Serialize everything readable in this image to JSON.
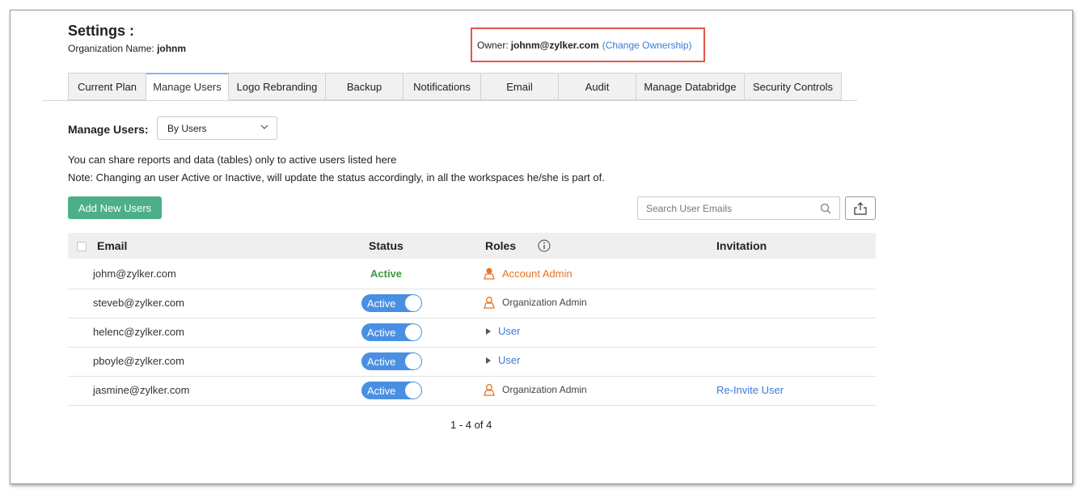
{
  "header": {
    "title": "Settings :",
    "org_label": "Organization Name:",
    "org_name": "johnm",
    "owner_label": "Owner:",
    "owner_email": "johnm@zylker.com",
    "change_ownership": "(Change Ownership)"
  },
  "tabs": [
    {
      "label": "Current Plan",
      "active": false
    },
    {
      "label": "Manage Users",
      "active": true
    },
    {
      "label": "Logo Rebranding",
      "active": false
    },
    {
      "label": "Backup",
      "active": false
    },
    {
      "label": "Notifications",
      "active": false
    },
    {
      "label": "Email",
      "active": false
    },
    {
      "label": "Audit",
      "active": false
    },
    {
      "label": "Manage Databridge",
      "active": false
    },
    {
      "label": "Security Controls",
      "active": false
    }
  ],
  "manage_users": {
    "label": "Manage Users:",
    "select_value": "By Users",
    "info_line1": "You can share reports and data (tables) only to active users listed here",
    "info_line2": "Note: Changing an user Active or Inactive, will update the status accordingly, in all the workspaces he/she is part of.",
    "add_button": "Add New Users",
    "search_placeholder": "Search User Emails"
  },
  "table": {
    "columns": {
      "email": "Email",
      "status": "Status",
      "roles": "Roles",
      "invitation": "Invitation"
    },
    "rows": [
      {
        "email": "johm@zylker.com",
        "status": "Active",
        "role": "Account Admin",
        "invitation": ""
      },
      {
        "email": "steveb@zylker.com",
        "status": "Active",
        "role": "Organization Admin",
        "invitation": ""
      },
      {
        "email": "helenc@zylker.com",
        "status": "Active",
        "role": "User",
        "invitation": ""
      },
      {
        "email": "pboyle@zylker.com",
        "status": "Active",
        "role": "User",
        "invitation": ""
      },
      {
        "email": "jasmine@zylker.com",
        "status": "Active",
        "role": "Organization Admin",
        "invitation": "Re-Invite User"
      }
    ]
  },
  "pagination": "1 - 4 of 4",
  "colors": {
    "accent_blue": "#3a7bd5",
    "toggle_blue": "#4a90e2",
    "add_green": "#4caf8a",
    "active_green": "#3b9a3b",
    "admin_orange": "#e47526",
    "highlight_red": "#e2574c"
  }
}
